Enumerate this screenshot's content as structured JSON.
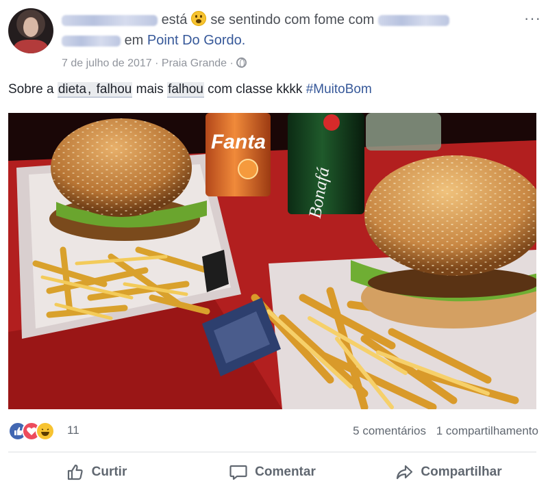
{
  "post": {
    "feeling_verb": "está",
    "feeling_text": "se sentindo com fome com",
    "location_prefix": "em",
    "location_name": "Point Do Gordo.",
    "timestamp": "7 de julho de 2017",
    "place": "Praia Grande",
    "separator": "·",
    "text_parts": [
      "Sobre a ",
      "dieta",
      ", ",
      "falhou",
      " mais ",
      "falhou",
      " com classe kkkk "
    ],
    "hashtag": "#MuitoBom",
    "more_label": "···"
  },
  "photo": {
    "can1": "Fanta",
    "can2": "Bonafá"
  },
  "footer": {
    "reaction_count": "11",
    "comments": "5 comentários",
    "shares": "1 compartilhamento"
  },
  "actions": {
    "like": "Curtir",
    "comment": "Comentar",
    "share": "Compartilhar"
  },
  "colors": {
    "link": "#365899",
    "meta": "#90949c",
    "action_text": "#606770"
  },
  "icons": [
    "globe-icon",
    "more-options-icon",
    "like-reaction-icon",
    "love-reaction-icon",
    "haha-reaction-icon",
    "thumbs-up-icon",
    "comment-icon",
    "share-icon"
  ]
}
